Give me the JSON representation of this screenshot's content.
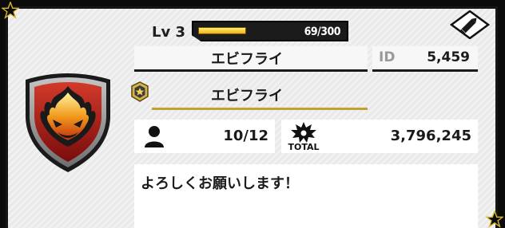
{
  "level": {
    "label": "Lv 3",
    "xp_text": "69/300",
    "xp_current": 69,
    "xp_max": 300
  },
  "player": {
    "name": "エビフライ",
    "id_label": "ID",
    "id_value": "5,459"
  },
  "guild": {
    "name": "エビフライ"
  },
  "stats": {
    "friends": "10/12",
    "total_label": "TOTAL",
    "total_value": "3,796,245"
  },
  "comment": "よろしくお願いします！",
  "icons": {
    "edit": "pencil-icon",
    "guild": "guild-rank-badge-icon",
    "friends": "person-icon",
    "total": "total-burst-icon",
    "emblem": "flame-shield-emblem",
    "corners": "star-icon"
  },
  "colors": {
    "accent_gold": "#bfa232",
    "xp_fill": "#f2b014",
    "emblem_red": "#b01818"
  }
}
